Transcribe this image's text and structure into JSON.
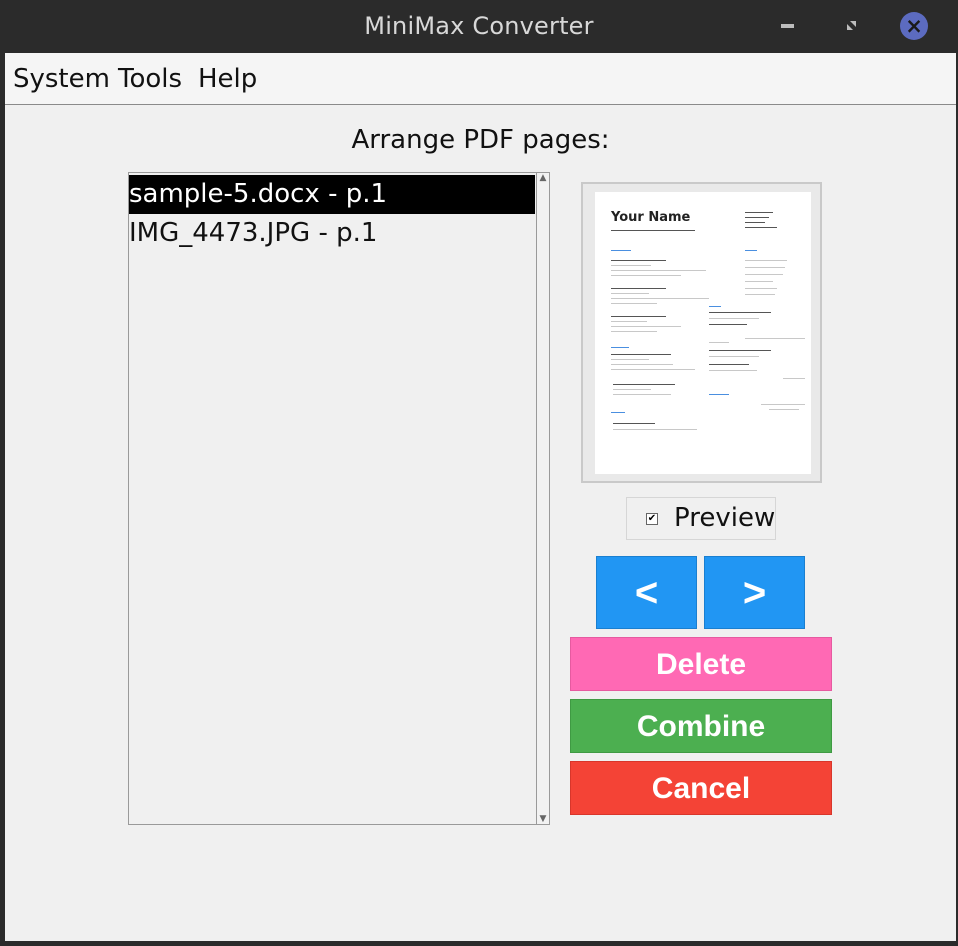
{
  "window": {
    "title": "MiniMax Converter"
  },
  "menu": {
    "items": [
      "System",
      "Tools",
      "Help"
    ]
  },
  "main": {
    "heading": "Arrange PDF pages:",
    "pages": [
      {
        "label": "sample-5.docx - p.1",
        "selected": true
      },
      {
        "label": "IMG_4473.JPG - p.1",
        "selected": false
      }
    ],
    "preview": {
      "doc_title": "Your Name",
      "checkbox_label": "Preview",
      "checked": true
    }
  },
  "buttons": {
    "prev": "<",
    "next": ">",
    "delete": "Delete",
    "combine": "Combine",
    "cancel": "Cancel"
  },
  "colors": {
    "nav": "#2196f3",
    "delete": "#ff69b4",
    "combine": "#4caf50",
    "cancel": "#f44336"
  }
}
